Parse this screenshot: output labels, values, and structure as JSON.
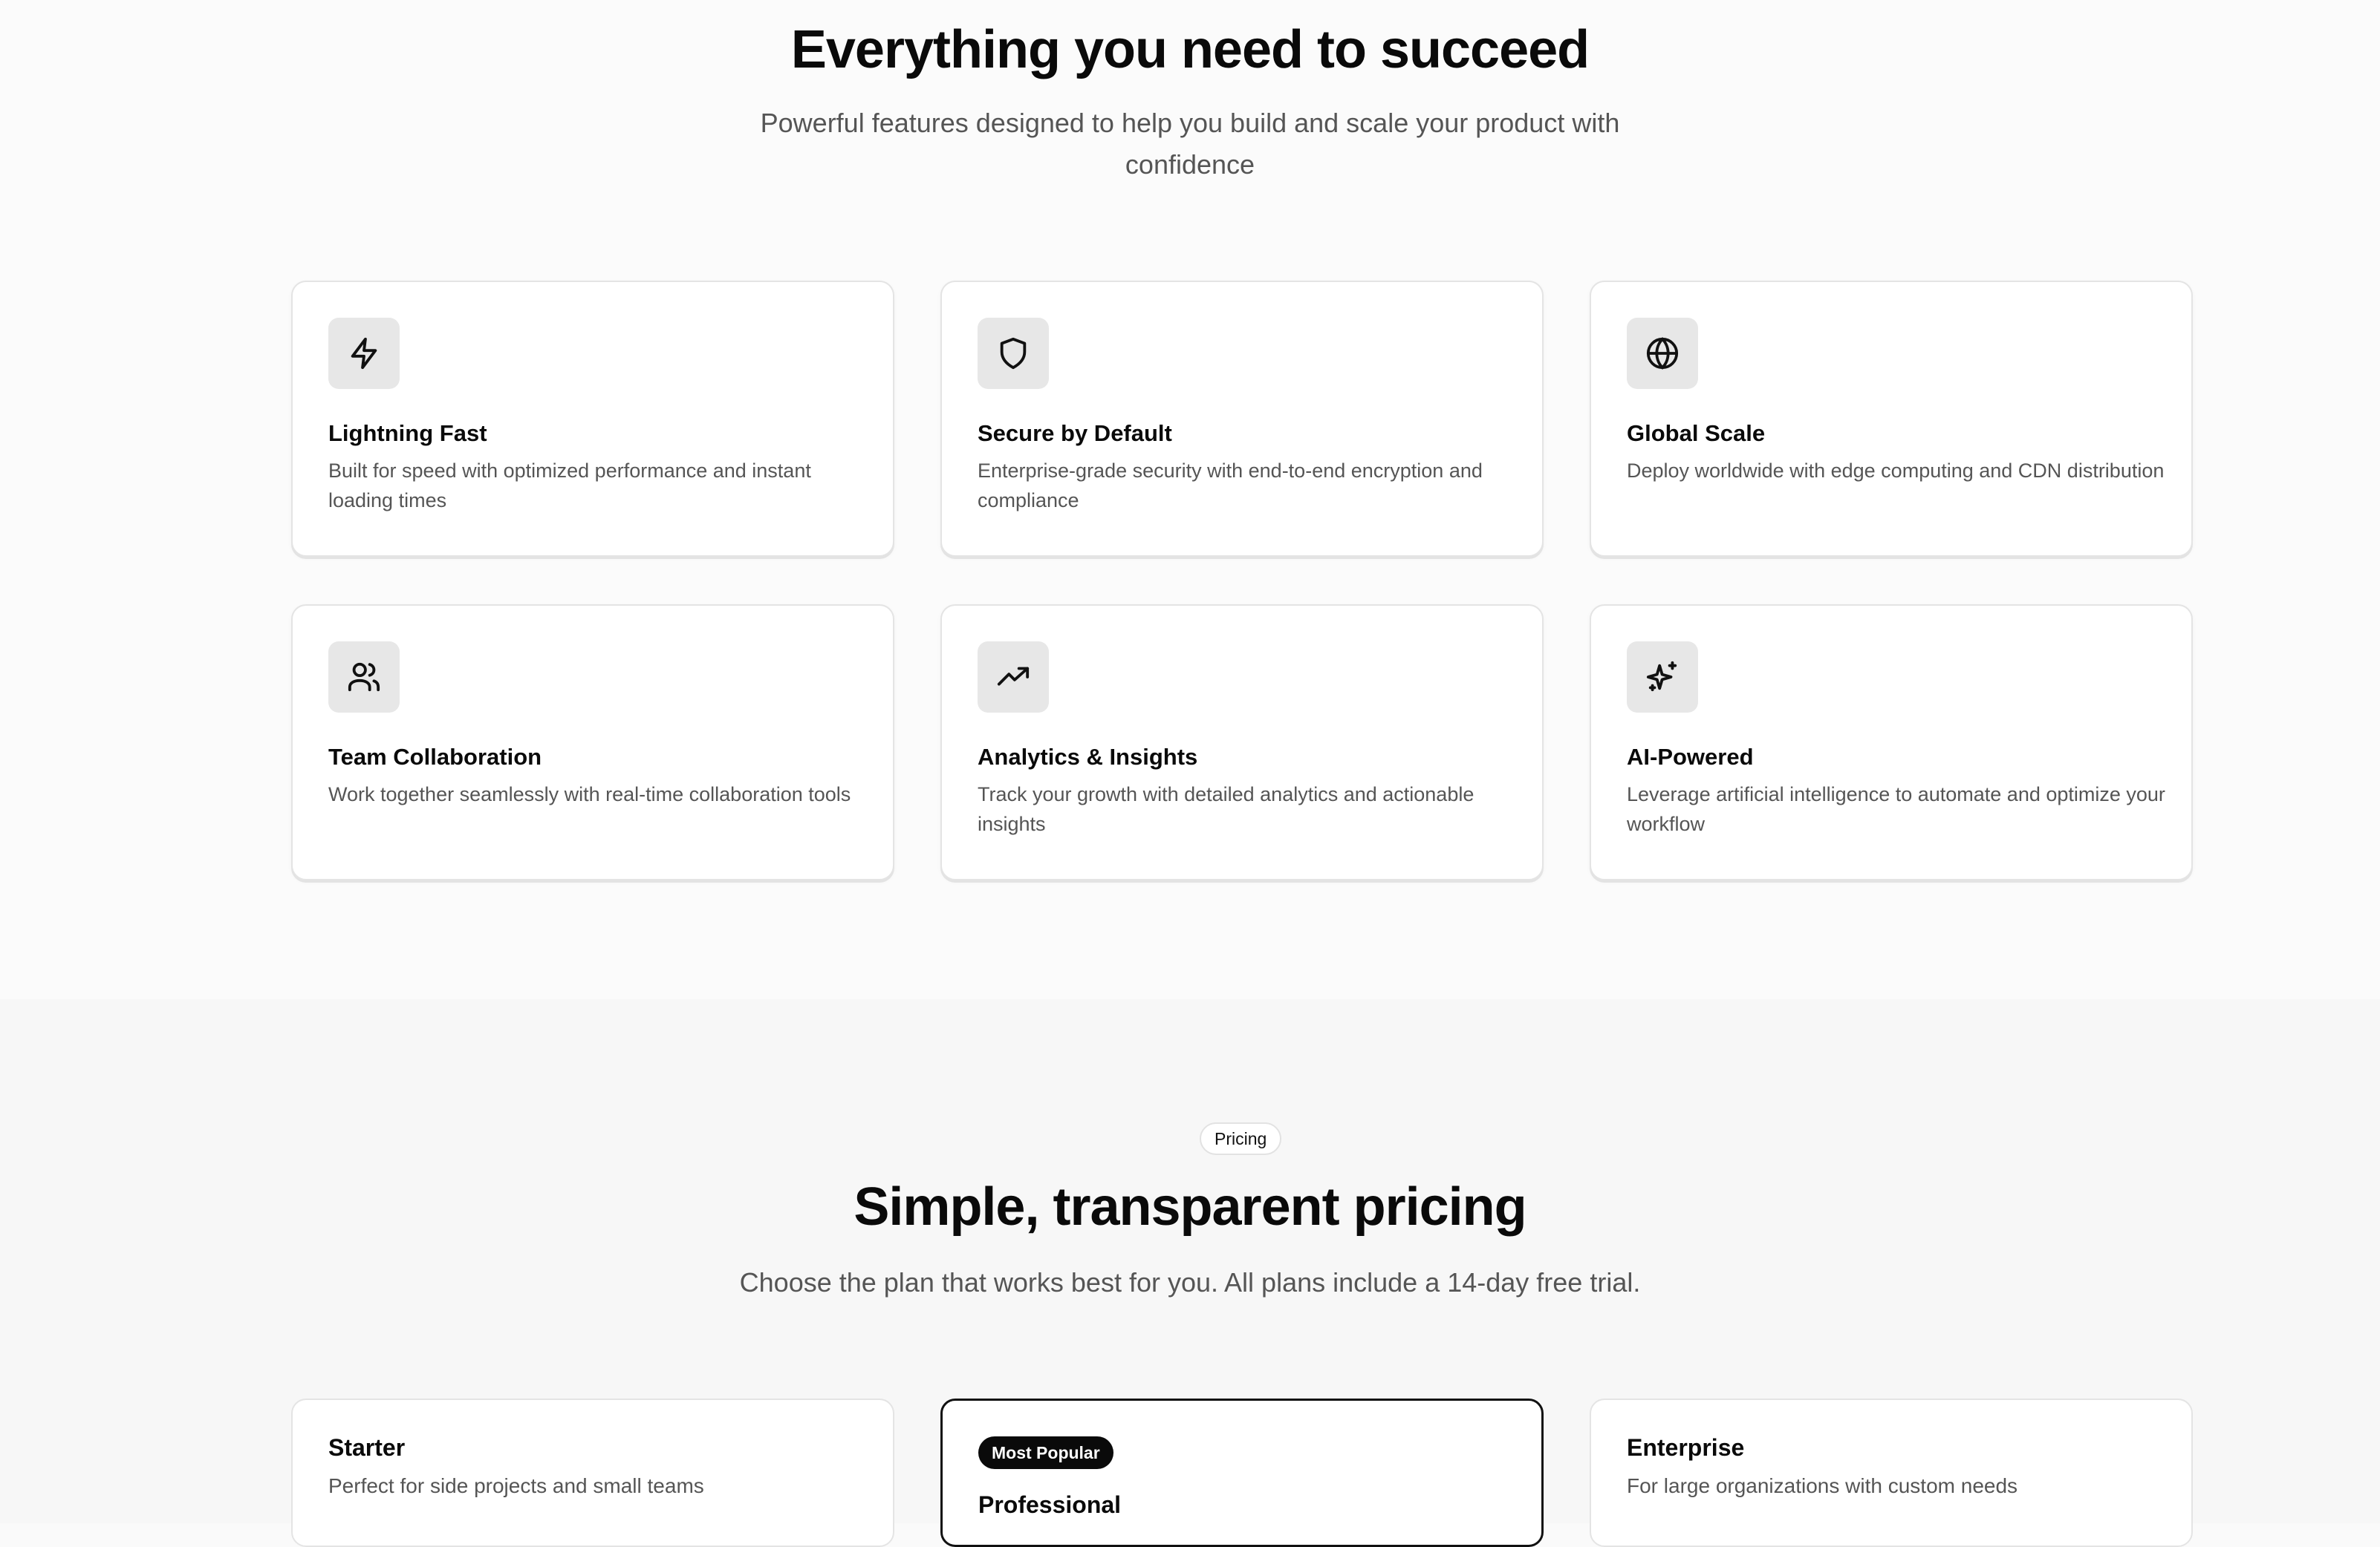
{
  "features": {
    "title": "Everything you need to succeed",
    "subtitle_line1": "Powerful features designed to help you build and scale your product with",
    "subtitle_line2": "confidence",
    "cards": [
      {
        "icon": "lightning-icon",
        "title": "Lightning Fast",
        "desc": "Built for speed with optimized performance and instant loading times"
      },
      {
        "icon": "shield-icon",
        "title": "Secure by Default",
        "desc": "Enterprise-grade security with end-to-end encryption and compliance"
      },
      {
        "icon": "globe-icon",
        "title": "Global Scale",
        "desc": "Deploy worldwide with edge computing and CDN distribution"
      },
      {
        "icon": "users-icon",
        "title": "Team Collaboration",
        "desc": "Work together seamlessly with real-time collaboration tools"
      },
      {
        "icon": "trending-up-icon",
        "title": "Analytics & Insights",
        "desc": "Track your growth with detailed analytics and actionable insights"
      },
      {
        "icon": "sparkles-icon",
        "title": "AI-Powered",
        "desc": "Leverage artificial intelligence to automate and optimize your workflow"
      }
    ]
  },
  "pricing": {
    "pill": "Pricing",
    "title": "Simple, transparent pricing",
    "subtitle": "Choose the plan that works best for you. All plans include a 14-day free trial.",
    "plans": [
      {
        "name": "Starter",
        "desc": "Perfect for side projects and small teams"
      },
      {
        "badge": "Most Popular",
        "name": "Professional"
      },
      {
        "name": "Enterprise",
        "desc": "For large organizations with custom needs"
      }
    ]
  }
}
